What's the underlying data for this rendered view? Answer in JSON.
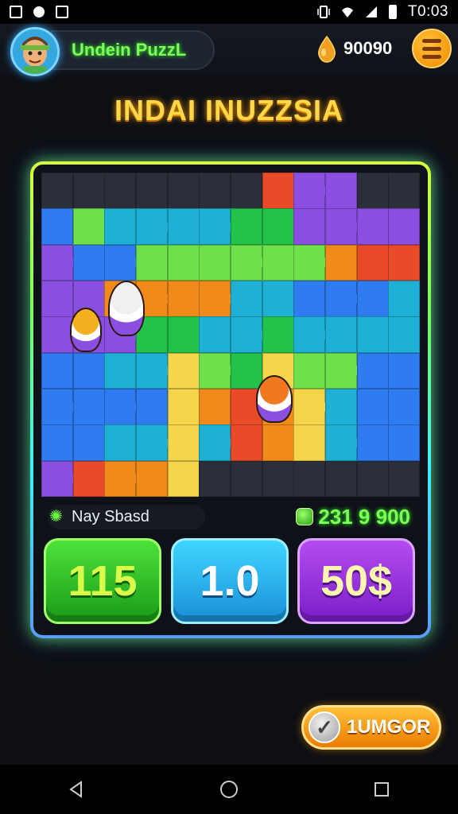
{
  "status_bar": {
    "time": "T0:03",
    "icons": [
      "gallery-icon",
      "message-icon",
      "shield-icon",
      "vibrate-icon",
      "wifi-icon",
      "signal-icon",
      "battery-icon"
    ]
  },
  "header": {
    "app_name": "Undein PuzzL",
    "coins": "90090",
    "coin_icon": "drop-icon",
    "menu_icon": "hamburger-icon"
  },
  "game_title": "INDAI INUZZSIA",
  "board": {
    "rows": 9,
    "cols": 12,
    "colors": [
      "#2a2f3a",
      "#23c24a",
      "#2f7bf0",
      "#8a4fe0",
      "#f08a1a",
      "#f5d54a",
      "#1fb0d6",
      "#6ee04a",
      "#e84a2a"
    ]
  },
  "info": {
    "label": "Nay Sbasd",
    "score": "231 9 900"
  },
  "buttons": {
    "green": "115",
    "blue": "1.0",
    "purple": "50$"
  },
  "action": {
    "label": "1UMGOR"
  },
  "colors": {
    "accent_green": "#7dff5a",
    "accent_gold": "#ffd84a",
    "background": "#0d0f14"
  }
}
